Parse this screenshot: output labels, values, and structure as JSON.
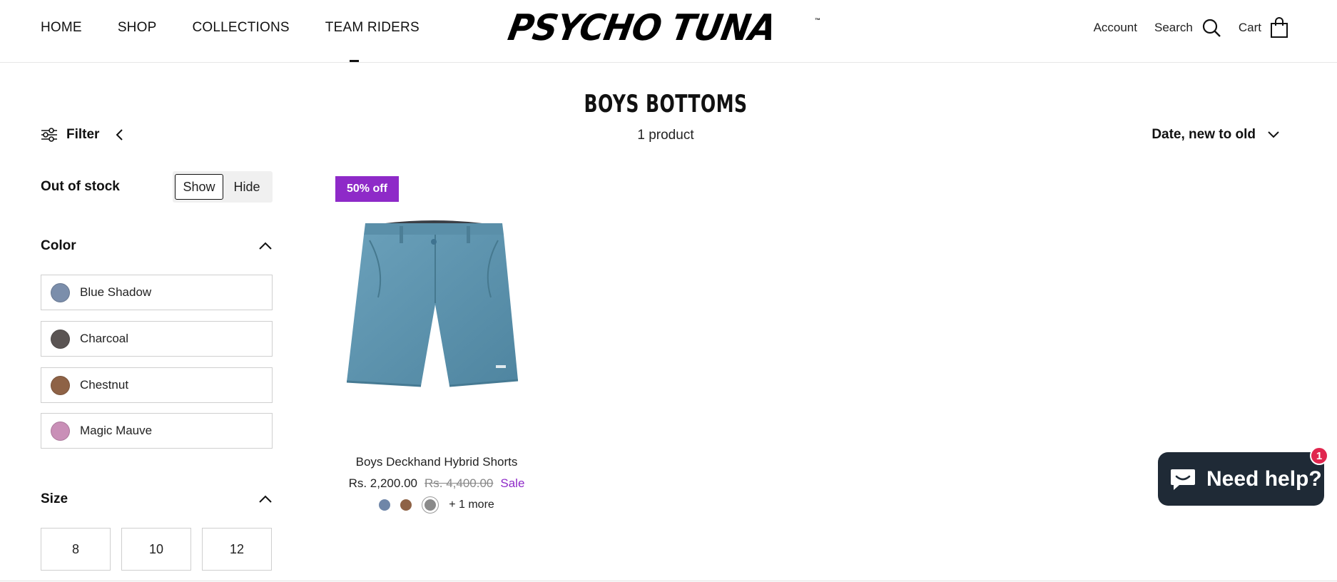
{
  "header": {
    "nav": [
      "HOME",
      "SHOP",
      "COLLECTIONS",
      "TEAM RIDERS"
    ],
    "logo_text": "PSYCHO TUNA",
    "logo_tm": "™",
    "account": "Account",
    "search": "Search",
    "cart": "Cart"
  },
  "page": {
    "title": "BOYS BOTTOMS",
    "count": "1 product"
  },
  "filter": {
    "label": "Filter",
    "out_of_stock": {
      "label": "Out of stock",
      "show": "Show",
      "hide": "Hide",
      "selected": "Show"
    },
    "color": {
      "label": "Color",
      "options": [
        {
          "name": "Blue Shadow",
          "color": "#7b8eab"
        },
        {
          "name": "Charcoal",
          "color": "#5a5453"
        },
        {
          "name": "Chestnut",
          "color": "#8e6246"
        },
        {
          "name": "Magic Mauve",
          "color": "#c98fb7"
        }
      ]
    },
    "size": {
      "label": "Size",
      "options": [
        "8",
        "10",
        "12"
      ]
    }
  },
  "sort": {
    "label": "Date, new to old"
  },
  "product": {
    "badge": "50% off",
    "title": "Boys Deckhand Hybrid Shorts",
    "price": "Rs. 2,200.00",
    "compare_price": "Rs. 4,400.00",
    "sale_label": "Sale",
    "swatches": [
      "#6f86a8",
      "#8e6246",
      "#8a8a8a"
    ],
    "more": "+ 1 more",
    "image_color": "#5d93ad"
  },
  "chat": {
    "label": "Need help?",
    "badge": "1"
  },
  "colors": {
    "accent": "#8e2ac8",
    "chat_bg": "#1f2a36",
    "chat_badge": "#e0264e"
  }
}
